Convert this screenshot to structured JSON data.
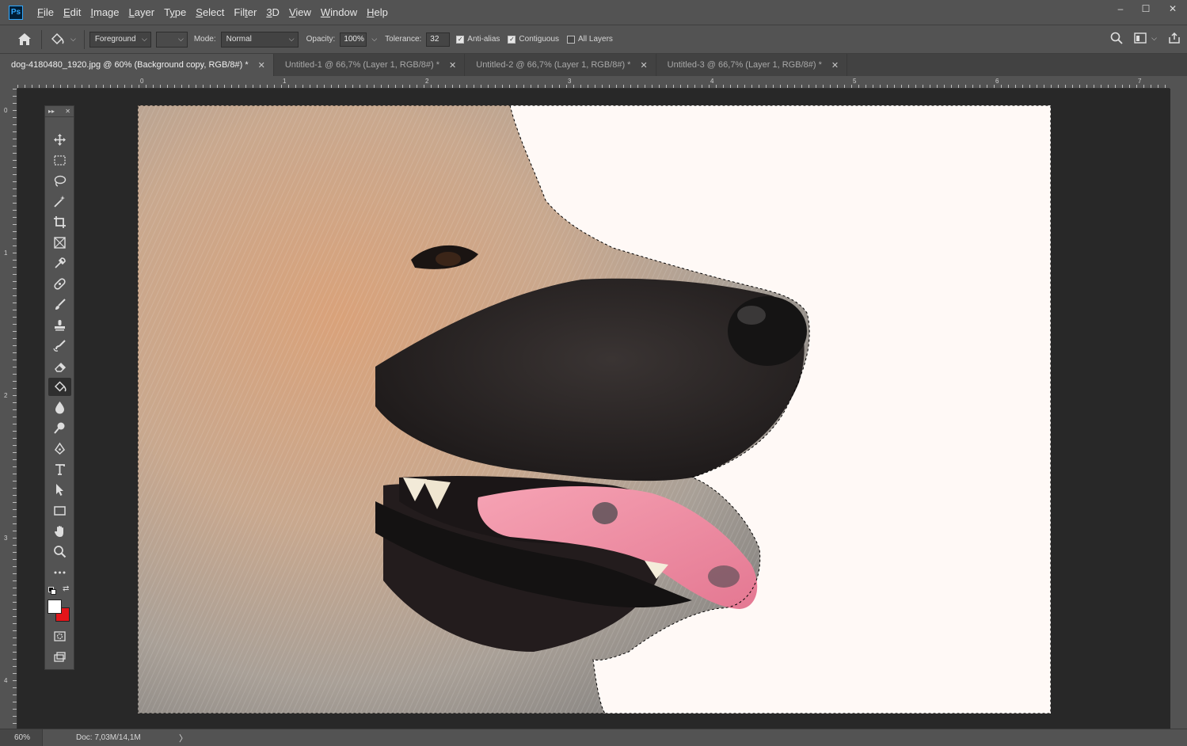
{
  "app": {
    "logo_text": "Ps"
  },
  "menu": [
    "File",
    "Edit",
    "Image",
    "Layer",
    "Type",
    "Select",
    "Filter",
    "3D",
    "View",
    "Window",
    "Help"
  ],
  "menu_underline": [
    "F",
    "E",
    "I",
    "L",
    "y",
    "S",
    "t",
    "3",
    "V",
    "W",
    "H"
  ],
  "window_controls": {
    "minimize": "–",
    "maximize": "☐",
    "close": "✕"
  },
  "options": {
    "fill_source": "Foreground",
    "mode_label": "Mode:",
    "mode_value": "Normal",
    "opacity_label": "Opacity:",
    "opacity_value": "100%",
    "tolerance_label": "Tolerance:",
    "tolerance_value": "32",
    "anti_alias_label": "Anti-alias",
    "anti_alias_checked": true,
    "contiguous_label": "Contiguous",
    "contiguous_checked": true,
    "all_layers_label": "All Layers",
    "all_layers_checked": false
  },
  "tabs": [
    {
      "label": "dog-4180480_1920.jpg @ 60% (Background copy, RGB/8#) *",
      "active": true
    },
    {
      "label": "Untitled-1 @ 66,7% (Layer 1, RGB/8#) *",
      "active": false
    },
    {
      "label": "Untitled-2 @ 66,7% (Layer 1, RGB/8#) *",
      "active": false
    },
    {
      "label": "Untitled-3 @ 66,7% (Layer 1, RGB/8#) *",
      "active": false
    }
  ],
  "ruler_top_labels": [
    "0",
    "1",
    "2",
    "3",
    "4",
    "5",
    "6",
    "7"
  ],
  "ruler_left_labels": [
    "0",
    "1",
    "2",
    "3",
    "4"
  ],
  "tools": [
    "move-tool",
    "marquee-tool",
    "lasso-tool",
    "magic-wand-tool",
    "crop-tool",
    "frame-tool",
    "eyedropper-tool",
    "healing-brush-tool",
    "brush-tool",
    "clone-stamp-tool",
    "history-brush-tool",
    "eraser-tool",
    "paint-bucket-tool",
    "blur-tool",
    "dodge-tool",
    "pen-tool",
    "type-tool",
    "path-selection-tool",
    "rectangle-tool",
    "hand-tool",
    "zoom-tool",
    "more-tools"
  ],
  "active_tool": "paint-bucket-tool",
  "colors": {
    "foreground": "#ffffff",
    "background": "#e3151a",
    "canvas_bg": "#fff9f6"
  },
  "status": {
    "zoom": "60%",
    "doc_info": "Doc: 7,03M/14,1M",
    "arrow": "〉"
  }
}
